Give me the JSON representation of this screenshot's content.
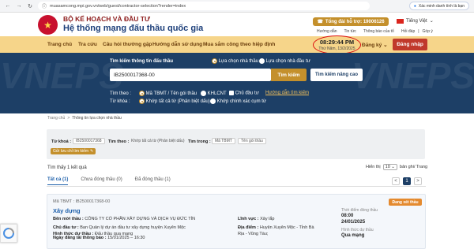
{
  "browser": {
    "url": "muasamcong.mpi.gov.vn/web/guest/contractor-selection?render=index",
    "verify_label": "Xác minh danh tính là bạn"
  },
  "header": {
    "ministry": "BỘ KẾ HOẠCH VÀ ĐẦU TƯ",
    "system": "Hệ thống mạng đấu thầu quốc gia",
    "hotline": "Tổng đài hỗ trợ: 19006126",
    "language": "Tiếng Việt",
    "links": [
      "Hướng dẫn",
      "Tin tức",
      "Thông báo của tổ"
    ],
    "links2": [
      "Hỏi đáp",
      "Góp ý"
    ]
  },
  "nav": {
    "items": [
      "Trang chủ",
      "Tra cứu",
      "Câu hỏi thường gặp",
      "Hướng dẫn sử dụng",
      "Mua sắm công theo hiệp định"
    ],
    "time": "08:29:44 PM",
    "date": "Thứ Năm, 13/2/2025",
    "register": "Đăng ký",
    "login": "Đăng nhập"
  },
  "search": {
    "label": "Tìm kiếm thông tin đấu thầu",
    "opt_contractor": "Lựa chọn nhà thầu",
    "opt_investor": "Lựa chọn nhà đầu tư",
    "value": "IB2500017368-00",
    "search_btn": "Tìm kiếm",
    "adv_btn": "Tìm kiếm nâng cao",
    "find_by_label": "Tìm theo :",
    "find_by": [
      "Mã TBMT / Tên gói thầu",
      "KHLCNT",
      "Chủ đầu tư"
    ],
    "guide": "Hướng dẫn tìm kiếm",
    "keyword_label": "Từ khóa :",
    "keyword_opts": [
      "Khớp tất cả từ (Phân biệt dấu)",
      "Khớp chính xác cụm từ"
    ]
  },
  "breadcrumb": [
    "Trang chủ",
    ">",
    "Thông tin lựa chọn nhà thầu"
  ],
  "filters": {
    "kw_label": "Từ khoá :",
    "kw_value": "IB2500017368",
    "theo_label": "Tìm theo :",
    "theo_value": "Khớp tất cả từ (Phân biệt dấu)",
    "trong_label": "Tìm trong :",
    "trong_tags": [
      "Mã TBMT",
      "Tên gói thầu"
    ],
    "submit": "Gửi lưu chỉ tìm kiếm"
  },
  "results": {
    "found": "Tìm thấy 1 kết quả",
    "show_label": "Hiển thị",
    "per_page": "10",
    "per_page_suffix": "bản ghi/ Trang",
    "tabs": [
      "Tất cả (1)",
      "Chưa đóng thầu (0)",
      "Đã đóng thầu (1)"
    ],
    "pages": [
      "<",
      "1",
      ">"
    ]
  },
  "card": {
    "code": "Mã TBMT : IB2500017368-00",
    "title": "Xây dựng",
    "status": "Đang xét thầu",
    "contractor_label": "Bên mời thầu :",
    "contractor": "CÔNG TY CỔ PHẦN XÂY DỰNG VÀ DỊCH VỤ ĐỨC TÍN",
    "investor_label": "Chủ đầu tư :",
    "investor": "Ban Quản lý dự án đầu tư xây dựng huyện Xuyên Mộc",
    "method_label": "Hình thức dự thầu :",
    "method": "Đấu thầu qua mạng",
    "posted_label": "Ngày đăng tải thông báo :",
    "posted": "15/01/2025 – 16:30",
    "field_label": "Lĩnh vực :",
    "field": "Xây lắp",
    "place_label": "Địa điểm :",
    "place": "Huyện Xuyên Mộc - Tỉnh Bà",
    "place2": "Rịa - Vũng Tàu;",
    "close_time_label": "Thời điểm đóng thầu",
    "close_time": "08:00",
    "close_date": "24/01/2025",
    "choose_label": "Hình thức dự thầu",
    "choose": "Qua mạng"
  },
  "colors": {
    "navy": "#1d3f66",
    "gold": "#c4902c",
    "nav_bg": "#f6d58a",
    "login": "#c0392b",
    "badge": "#e48a2f"
  }
}
